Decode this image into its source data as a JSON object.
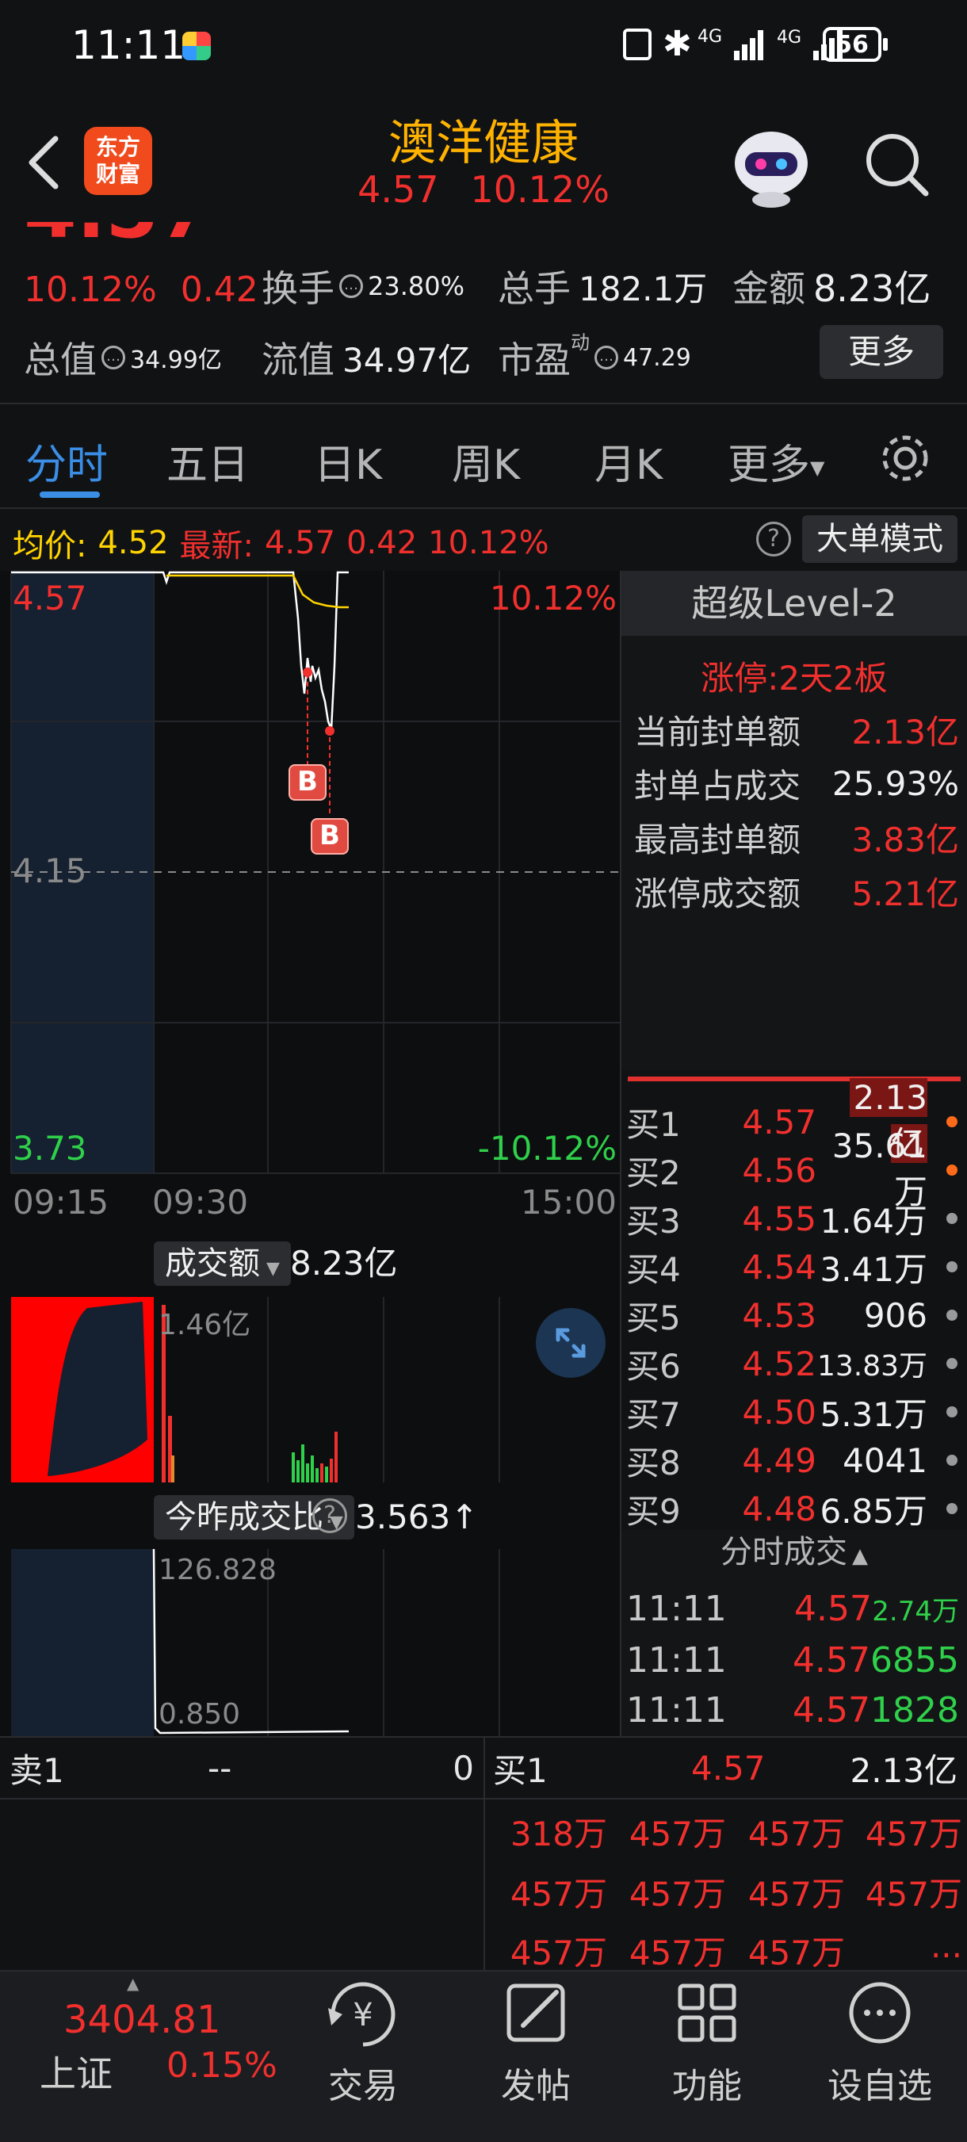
{
  "status_bar": {
    "time": "11:11",
    "network_label": "4G",
    "battery": "56"
  },
  "header": {
    "logo_line1": "东方",
    "logo_line2": "财富",
    "stock_name": "澳洋健康",
    "price": "4.57",
    "change_pct": "10.12%"
  },
  "quote": {
    "big_price_partial": "4.57",
    "change_pct": "10.12%",
    "change_abs": "0.42",
    "turnover_label": "换手",
    "turnover_value": "23.80%",
    "volume_label": "总手",
    "volume_value": "182.1万",
    "amount_label": "金额",
    "amount_value": "8.23亿",
    "mktcap_label": "总值",
    "mktcap_value": "34.99亿",
    "float_label": "流值",
    "float_value": "34.97亿",
    "pe_label": "市盈",
    "pe_sup": "动",
    "pe_value": "47.29",
    "more_button": "更多"
  },
  "tabs": [
    "分时",
    "五日",
    "日K",
    "周K",
    "月K",
    "更多"
  ],
  "avg_bar": {
    "avg_label": "均价:",
    "avg_value": "4.52",
    "latest_label": "最新:",
    "latest_price": "4.57",
    "latest_change": "0.42",
    "latest_pct": "10.12%",
    "mode_button": "大单模式"
  },
  "intraday_chart": {
    "top_price": "4.57",
    "top_pct": "10.12%",
    "mid_price": "4.15",
    "bottom_price": "3.73",
    "bottom_pct": "-10.12%",
    "time_start": "09:15",
    "time_open": "09:30",
    "time_end": "15:00",
    "marker": "B"
  },
  "volume_panel": {
    "selector_label": "成交额",
    "total": "8.23亿",
    "max_label": "1.46亿"
  },
  "ratio_panel": {
    "selector_label": "今昨成交比",
    "value": "3.563↑",
    "max_label": "126.828",
    "min_label": "0.850"
  },
  "level2": {
    "title": "超级Level-2",
    "limit_up": "涨停:2天2板",
    "rows": [
      {
        "key": "当前封单额",
        "value": "2.13亿"
      },
      {
        "key": "封单占成交",
        "value": "25.93%"
      },
      {
        "key": "最高封单额",
        "value": "3.83亿"
      },
      {
        "key": "涨停成交额",
        "value": "5.21亿"
      }
    ]
  },
  "order_book": [
    {
      "label": "买1",
      "price": "4.57",
      "volume": "2.13亿",
      "dot": "#ff6a1a",
      "highlight": true
    },
    {
      "label": "买2",
      "price": "4.56",
      "volume": "35.61万",
      "dot": "#ff6a1a"
    },
    {
      "label": "买3",
      "price": "4.55",
      "volume": "1.64万",
      "dot": "#9a9a9a"
    },
    {
      "label": "买4",
      "price": "4.54",
      "volume": "3.41万",
      "dot": "#9a9a9a"
    },
    {
      "label": "买5",
      "price": "4.53",
      "volume": "906",
      "dot": "#9a9a9a"
    },
    {
      "label": "买6",
      "price": "4.52",
      "volume": "13.83万",
      "dot": "#9a9a9a"
    },
    {
      "label": "买7",
      "price": "4.50",
      "volume": "5.31万",
      "dot": "#9a9a9a"
    },
    {
      "label": "买8",
      "price": "4.49",
      "volume": "4041",
      "dot": "#9a9a9a"
    },
    {
      "label": "买9",
      "price": "4.48",
      "volume": "6.85万",
      "dot": "#9a9a9a"
    }
  ],
  "trades": {
    "title": "分时成交",
    "rows": [
      {
        "time": "11:11",
        "price": "4.57",
        "volume": "2.74万"
      },
      {
        "time": "11:11",
        "price": "4.57",
        "volume": "6855"
      },
      {
        "time": "11:11",
        "price": "4.57",
        "volume": "1828"
      }
    ]
  },
  "queue": {
    "sell_label": "卖1",
    "sell_price": "--",
    "sell_volume": "0",
    "buy_label": "买1",
    "buy_price": "4.57",
    "buy_volume": "2.13亿",
    "cells": [
      "318万",
      "457万",
      "457万",
      "457万",
      "457万",
      "457万",
      "457万",
      "457万",
      "457万",
      "457万",
      "457万",
      "..."
    ]
  },
  "bottom_nav": {
    "index_value": "3404.81",
    "index_name": "上证",
    "index_pct": "0.15%",
    "items": [
      "交易",
      "发帖",
      "功能",
      "设自选"
    ]
  },
  "colors": {
    "up": "#f1302e",
    "down": "#2fd04a",
    "accent": "#ffd400",
    "tab_active": "#3a8ee6"
  }
}
